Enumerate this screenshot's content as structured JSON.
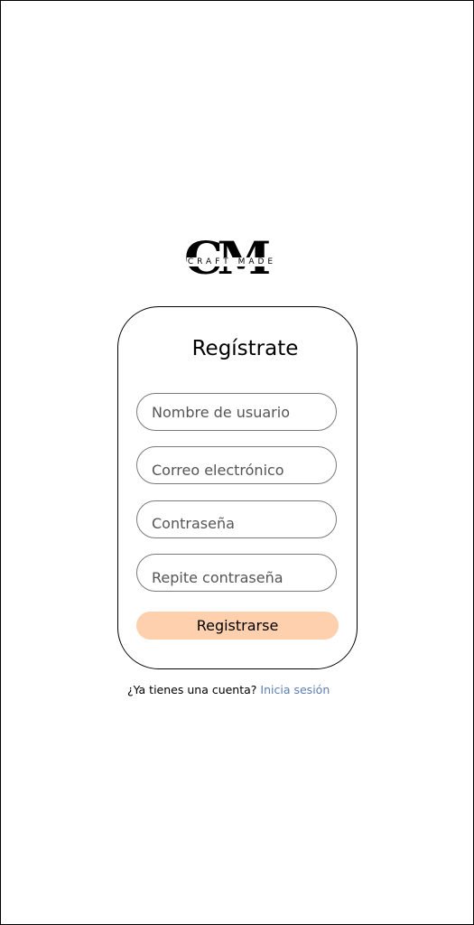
{
  "logo": {
    "monogram": "CM",
    "wordmark": "CRAFT MADE"
  },
  "form": {
    "title": "Regístrate",
    "username_placeholder": "Nombre de usuario",
    "email_placeholder": "Correo electrónico",
    "password_placeholder": "Contraseña",
    "repeat_password_placeholder": "Repite contraseña",
    "submit_label": "Registrarse"
  },
  "footer": {
    "prompt": "¿Ya tienes una cuenta?",
    "login_link": "Inicia sesión"
  },
  "colors": {
    "button_bg": "#ffd0ad",
    "link": "#5b7db5",
    "border": "#000000"
  }
}
